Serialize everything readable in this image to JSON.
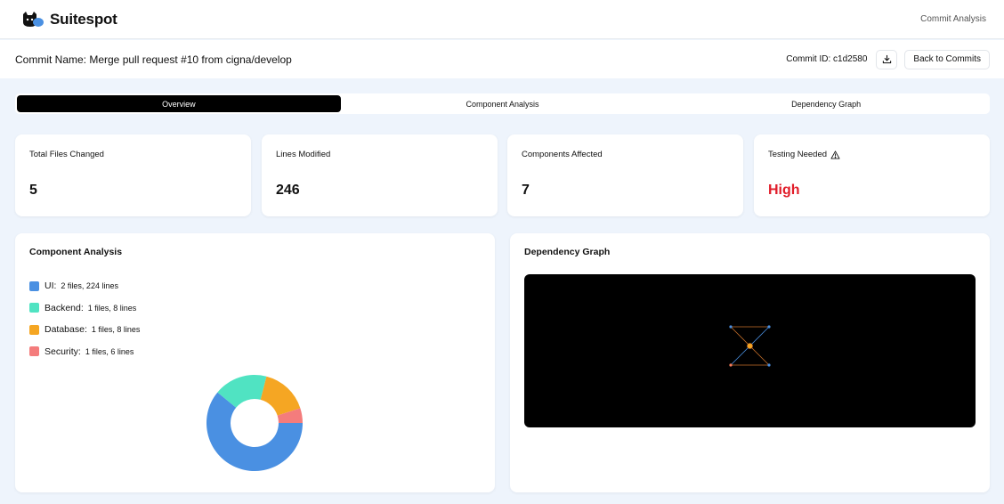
{
  "header": {
    "brand_name": "Suitespot",
    "nav_link": "Commit Analysis"
  },
  "commit": {
    "name": "Commit Name: Merge pull request #10 from cigna/develop",
    "id_label": "Commit ID: c1d2580",
    "back_label": "Back to Commits"
  },
  "tabs": [
    {
      "label": "Overview",
      "active": true
    },
    {
      "label": "Component Analysis",
      "active": false
    },
    {
      "label": "Dependency Graph",
      "active": false
    }
  ],
  "stats": [
    {
      "label": "Total Files Changed",
      "value": "5"
    },
    {
      "label": "Lines Modified",
      "value": "246"
    },
    {
      "label": "Components Affected",
      "value": "7"
    },
    {
      "label": "Testing Needed",
      "value": "High",
      "icon": "warning-icon"
    }
  ],
  "component_panel": {
    "title": "Component Analysis",
    "legend": [
      {
        "name": "UI:",
        "detail": "2 files, 224 lines",
        "color": "#4a90e2"
      },
      {
        "name": "Backend:",
        "detail": "1 files, 8 lines",
        "color": "#50e3c2"
      },
      {
        "name": "Database:",
        "detail": "1 files, 8 lines",
        "color": "#f5a623"
      },
      {
        "name": "Security:",
        "detail": "1 files, 6 lines",
        "color": "#f47c7c"
      }
    ]
  },
  "chart_data": {
    "type": "pie",
    "categories": [
      "UI",
      "Backend",
      "Database",
      "Security"
    ],
    "values": [
      224,
      8,
      8,
      6
    ],
    "colors": [
      "#4a90e2",
      "#50e3c2",
      "#f5a623",
      "#f47c7c"
    ],
    "display_fractions": [
      0.61,
      0.18,
      0.16,
      0.05
    ],
    "title": ""
  },
  "dependency_panel": {
    "title": "Dependency Graph",
    "nodes": [
      {
        "color": "#4a90e2"
      },
      {
        "color": "#4a90e2"
      },
      {
        "color": "#f47c5c"
      },
      {
        "color": "#4a90e2"
      },
      {
        "color": "#f5a623"
      }
    ]
  }
}
